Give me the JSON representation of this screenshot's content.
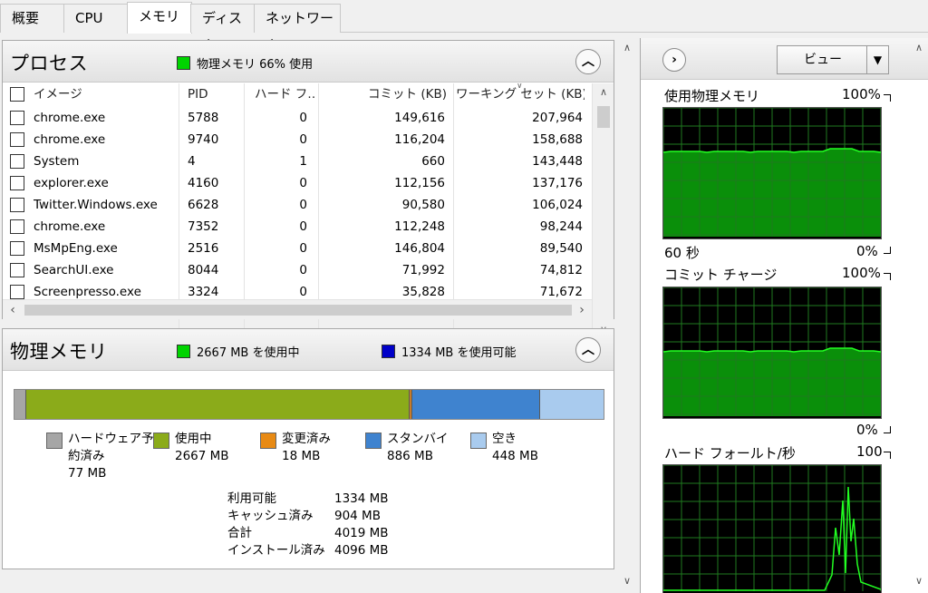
{
  "tabs": [
    {
      "label": "概要"
    },
    {
      "label": "CPU"
    },
    {
      "label": "メモリ"
    },
    {
      "label": "ディスク"
    },
    {
      "label": "ネットワーク"
    }
  ],
  "process_panel": {
    "title": "プロセス",
    "indicator": "物理メモリ 66% 使用",
    "indicator_color": "#00d400",
    "columns": [
      "イメージ",
      "PID",
      "ハード フ…",
      "コミット (KB)",
      "ワーキング セット (KB)"
    ],
    "rows": [
      {
        "image": "chrome.exe",
        "pid": "5788",
        "hard": "0",
        "commit": "149,616",
        "working": "207,964"
      },
      {
        "image": "chrome.exe",
        "pid": "9740",
        "hard": "0",
        "commit": "116,204",
        "working": "158,688"
      },
      {
        "image": "System",
        "pid": "4",
        "hard": "1",
        "commit": "660",
        "working": "143,448"
      },
      {
        "image": "explorer.exe",
        "pid": "4160",
        "hard": "0",
        "commit": "112,156",
        "working": "137,176"
      },
      {
        "image": "Twitter.Windows.exe",
        "pid": "6628",
        "hard": "0",
        "commit": "90,580",
        "working": "106,024"
      },
      {
        "image": "chrome.exe",
        "pid": "7352",
        "hard": "0",
        "commit": "112,248",
        "working": "98,244"
      },
      {
        "image": "MsMpEng.exe",
        "pid": "2516",
        "hard": "0",
        "commit": "146,804",
        "working": "89,540"
      },
      {
        "image": "SearchUI.exe",
        "pid": "8044",
        "hard": "0",
        "commit": "71,992",
        "working": "74,812"
      },
      {
        "image": "Screenpresso.exe",
        "pid": "3324",
        "hard": "0",
        "commit": "35,828",
        "working": "71,672"
      }
    ]
  },
  "memory_panel": {
    "title": "物理メモリ",
    "in_use_label": "2667 MB を使用中",
    "in_use_color": "#00d400",
    "available_label": "1334 MB を使用可能",
    "available_color": "#0000c8",
    "bar": [
      {
        "name": "hardware-reserved",
        "mb": 77,
        "color": "#a6a6a6"
      },
      {
        "name": "in-use",
        "mb": 2667,
        "color": "#8bab1a"
      },
      {
        "name": "modified",
        "mb": 18,
        "color": "#c77b2a"
      },
      {
        "name": "standby",
        "mb": 886,
        "color": "#3f83cf"
      },
      {
        "name": "free",
        "mb": 448,
        "color": "#a9cbee"
      }
    ],
    "legend": [
      {
        "lines": [
          "ハードウェア予",
          "約済み",
          "77 MB"
        ],
        "color": "#a6a6a6"
      },
      {
        "lines": [
          "使用中",
          "2667 MB"
        ],
        "color": "#8bab1a"
      },
      {
        "lines": [
          "変更済み",
          "18 MB"
        ],
        "color": "#e88a14"
      },
      {
        "lines": [
          "スタンバイ",
          "886 MB"
        ],
        "color": "#3f83cf"
      },
      {
        "lines": [
          "空き",
          "448 MB"
        ],
        "color": "#a9cbee"
      }
    ],
    "stats": [
      {
        "label": "利用可能",
        "value": "1334 MB"
      },
      {
        "label": "キャッシュ済み",
        "value": "904 MB"
      },
      {
        "label": "合計",
        "value": "4019 MB"
      },
      {
        "label": "インストール済み",
        "value": "4096 MB"
      }
    ]
  },
  "graphs_panel": {
    "view_label": "ビュー",
    "graphs": [
      {
        "title": "使用物理メモリ",
        "max": "100%",
        "time_label": "60 秒",
        "min": "0%",
        "kind": "fill",
        "level_percent": 66
      },
      {
        "title": "コミット チャージ",
        "max": "100%",
        "time_label": "",
        "min": "0%",
        "kind": "fill",
        "level_percent": 51
      },
      {
        "title": "ハード フォールト/秒",
        "max": "100",
        "time_label": "",
        "min": "",
        "kind": "spikes"
      }
    ]
  }
}
